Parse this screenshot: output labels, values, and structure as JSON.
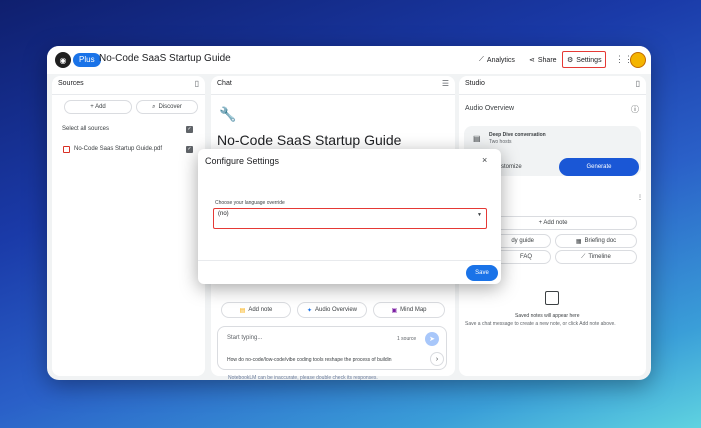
{
  "app": {
    "plan_badge": "Plus",
    "title": "No-Code SaaS Startup Guide"
  },
  "toolbar": {
    "analytics_label": "Analytics",
    "share_label": "Share",
    "settings_label": "Settings"
  },
  "sources": {
    "header": "Sources",
    "add_label": "+ Add",
    "discover_label": "Discover",
    "select_all_label": "Select all sources",
    "items": [
      {
        "name": "No-Code Saas Startup Guide.pdf"
      }
    ]
  },
  "chat": {
    "header": "Chat",
    "notebook_title": "No-Code SaaS Startup Guide",
    "actions": {
      "add_note": "Add note",
      "audio_overview": "Audio Overview",
      "mind_map": "Mind Map"
    },
    "input_placeholder": "Start typing...",
    "source_count": "1 source",
    "suggestion": "How do no-code/low-code/vibe coding tools reshape the process of buildin"
  },
  "studio": {
    "header": "Studio",
    "audio_overview_label": "Audio Overview",
    "deep_dive_title": "Deep Dive conversation",
    "deep_dive_sub": "Two hosts",
    "customize_label": "stomize",
    "generate_label": "Generate",
    "add_note_label": "+ Add note",
    "study_guide_label": "dy guide",
    "briefing_label": "Briefing doc",
    "faq_label": "FAQ",
    "timeline_label": "Timeline",
    "saved_title": "Saved notes will appear here",
    "saved_sub": "Save a chat message to create a new note, or click Add note above."
  },
  "footer": "NotebookLM can be inaccurate, please double check its responses.",
  "modal": {
    "title": "Configure Settings",
    "close_symbol": "×",
    "field_label": "Choose your language override",
    "field_value": "(no)",
    "save_label": "Save"
  },
  "colors": {
    "accent": "#1a73e8",
    "highlight": "#e53935",
    "generate": "#1a57d6"
  }
}
